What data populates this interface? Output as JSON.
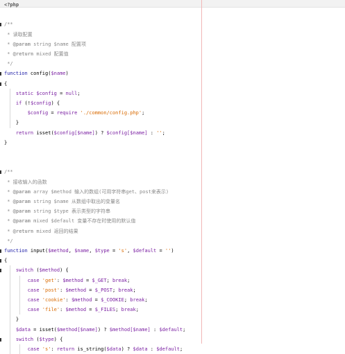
{
  "editor": {
    "lines": [
      [
        {
          "t": "<?php",
          "c": "tag"
        }
      ],
      [],
      [
        {
          "t": "/**",
          "c": "cmt"
        }
      ],
      [
        {
          "t": " * 读取配置",
          "c": "cmt"
        }
      ],
      [
        {
          "t": " * ",
          "c": "cmt"
        },
        {
          "t": "@param",
          "c": "doc"
        },
        {
          "t": " string $name 配置项",
          "c": "cmt"
        }
      ],
      [
        {
          "t": " * ",
          "c": "cmt"
        },
        {
          "t": "@return",
          "c": "doc"
        },
        {
          "t": " mixed 配置值",
          "c": "cmt"
        }
      ],
      [
        {
          "t": " */",
          "c": "cmt"
        }
      ],
      [
        {
          "t": "function",
          "c": "kw2"
        },
        {
          "t": " config(",
          "c": "fn"
        },
        {
          "t": "$name",
          "c": "var"
        },
        {
          "t": ")",
          "c": "fn"
        }
      ],
      [
        {
          "t": "{",
          "c": "fn"
        }
      ],
      [
        {
          "t": "    static ",
          "c": "kw"
        },
        {
          "t": "$config",
          "c": "var"
        },
        {
          "t": " = ",
          "c": "fn"
        },
        {
          "t": "null",
          "c": "kw"
        },
        {
          "t": ";",
          "c": "fn"
        }
      ],
      [
        {
          "t": "    if",
          "c": "kw"
        },
        {
          "t": " (!",
          "c": "fn"
        },
        {
          "t": "$config",
          "c": "var"
        },
        {
          "t": ") {",
          "c": "fn"
        }
      ],
      [
        {
          "t": "        $config",
          "c": "var"
        },
        {
          "t": " = ",
          "c": "fn"
        },
        {
          "t": "require",
          "c": "kw"
        },
        {
          "t": " ",
          "c": "fn"
        },
        {
          "t": "'./common/config.php'",
          "c": "str"
        },
        {
          "t": ";",
          "c": "fn"
        }
      ],
      [
        {
          "t": "    }",
          "c": "fn"
        }
      ],
      [
        {
          "t": "    return",
          "c": "kw"
        },
        {
          "t": " isset(",
          "c": "fn"
        },
        {
          "t": "$config[$name]",
          "c": "var"
        },
        {
          "t": ") ? ",
          "c": "fn"
        },
        {
          "t": "$config[$name]",
          "c": "var"
        },
        {
          "t": " : ",
          "c": "fn"
        },
        {
          "t": "''",
          "c": "str"
        },
        {
          "t": ";",
          "c": "fn"
        }
      ],
      [
        {
          "t": "}",
          "c": "fn"
        }
      ],
      [],
      [],
      [
        {
          "t": "/**",
          "c": "cmt"
        }
      ],
      [
        {
          "t": " * 接收输入的函数",
          "c": "cmt"
        }
      ],
      [
        {
          "t": " * ",
          "c": "cmt"
        },
        {
          "t": "@param",
          "c": "doc"
        },
        {
          "t": " array $method 输入的数组(可用字符串get、post来表示)",
          "c": "cmt"
        }
      ],
      [
        {
          "t": " * ",
          "c": "cmt"
        },
        {
          "t": "@param",
          "c": "doc"
        },
        {
          "t": " string $name 从数组中取出的变量名",
          "c": "cmt"
        }
      ],
      [
        {
          "t": " * ",
          "c": "cmt"
        },
        {
          "t": "@param",
          "c": "doc"
        },
        {
          "t": " string $type 表示类型的字符串",
          "c": "cmt"
        }
      ],
      [
        {
          "t": " * ",
          "c": "cmt"
        },
        {
          "t": "@param",
          "c": "doc"
        },
        {
          "t": " mixed $default 变量不存在时使用的默认值",
          "c": "cmt"
        }
      ],
      [
        {
          "t": " * ",
          "c": "cmt"
        },
        {
          "t": "@return",
          "c": "doc"
        },
        {
          "t": " mixed 返回的结果",
          "c": "cmt"
        }
      ],
      [
        {
          "t": " */",
          "c": "cmt"
        }
      ],
      [
        {
          "t": "function",
          "c": "kw2"
        },
        {
          "t": " input(",
          "c": "fn"
        },
        {
          "t": "$method",
          "c": "var"
        },
        {
          "t": ", ",
          "c": "fn"
        },
        {
          "t": "$name",
          "c": "var"
        },
        {
          "t": ", ",
          "c": "fn"
        },
        {
          "t": "$type",
          "c": "var"
        },
        {
          "t": " = ",
          "c": "fn"
        },
        {
          "t": "'s'",
          "c": "str"
        },
        {
          "t": ", ",
          "c": "fn"
        },
        {
          "t": "$default",
          "c": "var"
        },
        {
          "t": " = ",
          "c": "fn"
        },
        {
          "t": "''",
          "c": "str"
        },
        {
          "t": ")",
          "c": "fn"
        }
      ],
      [
        {
          "t": "{",
          "c": "fn"
        }
      ],
      [
        {
          "t": "    switch",
          "c": "kw"
        },
        {
          "t": " (",
          "c": "fn"
        },
        {
          "t": "$method",
          "c": "var"
        },
        {
          "t": ") {",
          "c": "fn"
        }
      ],
      [
        {
          "t": "        case ",
          "c": "kw"
        },
        {
          "t": "'get'",
          "c": "str"
        },
        {
          "t": ": ",
          "c": "fn"
        },
        {
          "t": "$method",
          "c": "var"
        },
        {
          "t": " = ",
          "c": "fn"
        },
        {
          "t": "$_GET",
          "c": "var"
        },
        {
          "t": "; ",
          "c": "fn"
        },
        {
          "t": "break",
          "c": "kw"
        },
        {
          "t": ";",
          "c": "fn"
        }
      ],
      [
        {
          "t": "        case ",
          "c": "kw"
        },
        {
          "t": "'post'",
          "c": "str"
        },
        {
          "t": ": ",
          "c": "fn"
        },
        {
          "t": "$method",
          "c": "var"
        },
        {
          "t": " = ",
          "c": "fn"
        },
        {
          "t": "$_POST",
          "c": "var"
        },
        {
          "t": "; ",
          "c": "fn"
        },
        {
          "t": "break",
          "c": "kw"
        },
        {
          "t": ";",
          "c": "fn"
        }
      ],
      [
        {
          "t": "        case ",
          "c": "kw"
        },
        {
          "t": "'cookie'",
          "c": "str"
        },
        {
          "t": ": ",
          "c": "fn"
        },
        {
          "t": "$method",
          "c": "var"
        },
        {
          "t": " = ",
          "c": "fn"
        },
        {
          "t": "$_COOKIE",
          "c": "var"
        },
        {
          "t": "; ",
          "c": "fn"
        },
        {
          "t": "break",
          "c": "kw"
        },
        {
          "t": ";",
          "c": "fn"
        }
      ],
      [
        {
          "t": "        case ",
          "c": "kw"
        },
        {
          "t": "'file'",
          "c": "str"
        },
        {
          "t": ": ",
          "c": "fn"
        },
        {
          "t": "$method",
          "c": "var"
        },
        {
          "t": " = ",
          "c": "fn"
        },
        {
          "t": "$_FILES",
          "c": "var"
        },
        {
          "t": "; ",
          "c": "fn"
        },
        {
          "t": "break",
          "c": "kw"
        },
        {
          "t": ";",
          "c": "fn"
        }
      ],
      [
        {
          "t": "    }",
          "c": "fn"
        }
      ],
      [
        {
          "t": "    $data",
          "c": "var"
        },
        {
          "t": " = isset(",
          "c": "fn"
        },
        {
          "t": "$method[$name]",
          "c": "var"
        },
        {
          "t": ") ? ",
          "c": "fn"
        },
        {
          "t": "$method[$name]",
          "c": "var"
        },
        {
          "t": " : ",
          "c": "fn"
        },
        {
          "t": "$default",
          "c": "var"
        },
        {
          "t": ";",
          "c": "fn"
        }
      ],
      [
        {
          "t": "    switch",
          "c": "kw"
        },
        {
          "t": " (",
          "c": "fn"
        },
        {
          "t": "$type",
          "c": "var"
        },
        {
          "t": ") {",
          "c": "fn"
        }
      ],
      [
        {
          "t": "        case ",
          "c": "kw"
        },
        {
          "t": "'s'",
          "c": "str"
        },
        {
          "t": ": ",
          "c": "fn"
        },
        {
          "t": "return",
          "c": "kw"
        },
        {
          "t": " is_string(",
          "c": "fn"
        },
        {
          "t": "$data",
          "c": "var"
        },
        {
          "t": ") ? ",
          "c": "fn"
        },
        {
          "t": "$data",
          "c": "var"
        },
        {
          "t": " : ",
          "c": "fn"
        },
        {
          "t": "$default",
          "c": "var"
        },
        {
          "t": ";",
          "c": "fn"
        }
      ]
    ]
  }
}
